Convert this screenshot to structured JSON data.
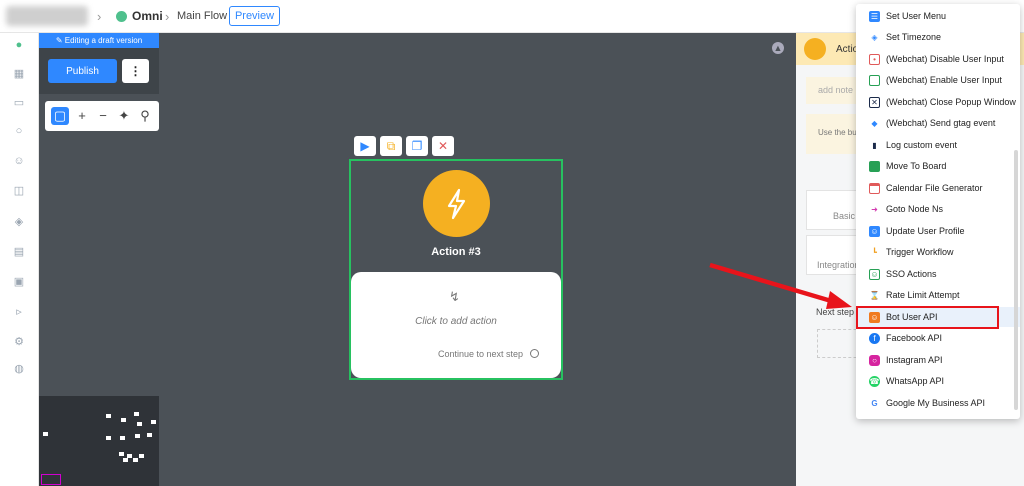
{
  "header": {
    "app": "Omni",
    "flow": "Main Flow",
    "preview_label": "Preview"
  },
  "editor": {
    "draft_banner": "Editing a draft version",
    "publish_label": "Publish",
    "more_label": "⋮"
  },
  "node": {
    "title": "Action #3",
    "add_action": "Click to add action",
    "continue": "Continue to next step"
  },
  "right_panel": {
    "header_title": "Actio",
    "note_placeholder": "add note",
    "hint": "Use the bu",
    "basic_label": "Basic A",
    "integration_label": "Integration",
    "next_step_label": "Next step"
  },
  "menu": {
    "items": [
      {
        "label": "Set User Menu",
        "icon": "menu-icon",
        "color": "#2f88ff"
      },
      {
        "label": "Set Timezone",
        "icon": "globe-icon",
        "color": "#2f88ff"
      },
      {
        "label": "(Webchat) Disable User Input",
        "icon": "input-disable-icon",
        "color": "#e05a5a"
      },
      {
        "label": "(Webchat) Enable User Input",
        "icon": "input-enable-icon",
        "color": "#27a055"
      },
      {
        "label": "(Webchat) Close Popup Window",
        "icon": "close-window-icon",
        "color": "#1b2a4a"
      },
      {
        "label": "(Webchat) Send gtag event",
        "icon": "tag-icon",
        "color": "#2f88ff"
      },
      {
        "label": "Log custom event",
        "icon": "bar-chart-icon",
        "color": "#1b2a4a"
      },
      {
        "label": "Move To Board",
        "icon": "board-icon",
        "color": "#27a055"
      },
      {
        "label": "Calendar File Generator",
        "icon": "calendar-icon",
        "color": "#e05a5a"
      },
      {
        "label": "Goto Node Ns",
        "icon": "goto-icon",
        "color": "#d23bb0"
      },
      {
        "label": "Update User Profile",
        "icon": "profile-icon",
        "color": "#2f88ff"
      },
      {
        "label": "Trigger Workflow",
        "icon": "workflow-icon",
        "color": "#f0a020"
      },
      {
        "label": "SSO Actions",
        "icon": "sso-icon",
        "color": "#27a055"
      },
      {
        "label": "Rate Limit Attempt",
        "icon": "hourglass-icon",
        "color": "#3a2a8a"
      },
      {
        "label": "Bot User API",
        "icon": "bot-user-icon",
        "color": "#f07a20"
      },
      {
        "label": "Facebook API",
        "icon": "facebook-icon",
        "color": "#1877f2"
      },
      {
        "label": "Instagram API",
        "icon": "instagram-icon",
        "color": "#d6249f"
      },
      {
        "label": "WhatsApp API",
        "icon": "whatsapp-icon",
        "color": "#25d366"
      },
      {
        "label": "Google My Business API",
        "icon": "google-icon",
        "color": "#4285f4"
      }
    ],
    "highlighted": "Bot User API"
  }
}
